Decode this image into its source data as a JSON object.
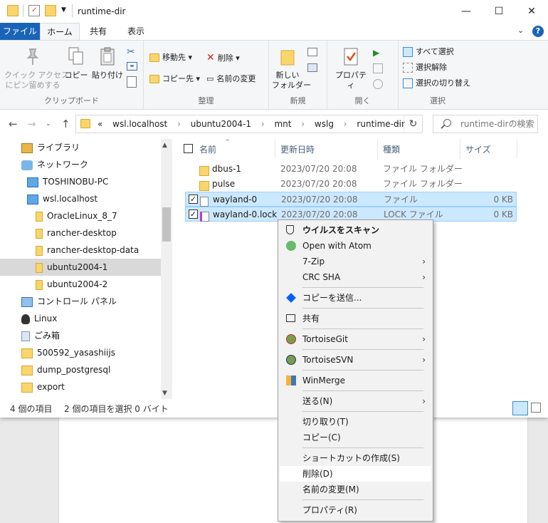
{
  "window": {
    "title": "runtime-dir",
    "controls": {
      "minimize": "—",
      "maximize": "☐",
      "close": "✕"
    }
  },
  "tabs": {
    "file": "ファイル",
    "home": "ホーム",
    "share": "共有",
    "view": "表示"
  },
  "ribbon": {
    "clipboard": {
      "label": "クリップボード",
      "pin": "クイック アクセス\nにピン留めする",
      "copy": "コピー",
      "paste": "貼り付け"
    },
    "organize": {
      "label": "整理",
      "move_to": "移動先",
      "copy_to": "コピー先",
      "delete": "削除",
      "rename": "名前の変更"
    },
    "new": {
      "label": "新規",
      "new_folder": "新しい\nフォルダー"
    },
    "open": {
      "label": "開く",
      "properties": "プロパティ"
    },
    "select": {
      "label": "選択",
      "select_all": "すべて選択",
      "select_none": "選択解除",
      "invert": "選択の切り替え"
    }
  },
  "address": {
    "overflow": "«",
    "path": [
      "wsl.localhost",
      "ubuntu2004-1",
      "mnt",
      "wslg",
      "runtime-dir"
    ],
    "separator": "›",
    "search_placeholder": "runtime-dirの検索"
  },
  "nav": {
    "items": [
      {
        "label": "ライブラリ",
        "icon": "library-icon",
        "selected": false
      },
      {
        "label": "ネットワーク",
        "icon": "network-icon",
        "selected": false
      },
      {
        "label": "TOSHINOBU-PC",
        "icon": "computer-icon",
        "selected": false
      },
      {
        "label": "wsl.localhost",
        "icon": "computer-icon",
        "selected": false
      },
      {
        "label": "OracleLinux_8_7",
        "icon": "network-folder-icon",
        "selected": false
      },
      {
        "label": "rancher-desktop",
        "icon": "network-folder-icon",
        "selected": false
      },
      {
        "label": "rancher-desktop-data",
        "icon": "network-folder-icon",
        "selected": false
      },
      {
        "label": "ubuntu2004-1",
        "icon": "network-folder-icon",
        "selected": true
      },
      {
        "label": "ubuntu2004-2",
        "icon": "network-folder-icon",
        "selected": false
      },
      {
        "label": "コントロール パネル",
        "icon": "control-panel-icon",
        "selected": false
      },
      {
        "label": "Linux",
        "icon": "linux-icon",
        "selected": false
      },
      {
        "label": "ごみ箱",
        "icon": "recycle-bin-icon",
        "selected": false
      },
      {
        "label": "500592_yasashiijs",
        "icon": "folder-icon",
        "selected": false
      },
      {
        "label": "dump_postgresql",
        "icon": "folder-icon",
        "selected": false
      },
      {
        "label": "export",
        "icon": "folder-icon",
        "selected": false
      }
    ]
  },
  "columns": {
    "name": "名前",
    "date": "更新日時",
    "type": "種類",
    "size": "サイズ"
  },
  "files": [
    {
      "name": "dbus-1",
      "date": "2023/07/20 20:08",
      "type": "ファイル フォルダー",
      "size": "",
      "icon": "folder-icon",
      "selected": false
    },
    {
      "name": "pulse",
      "date": "2023/07/20 20:08",
      "type": "ファイル フォルダー",
      "size": "",
      "icon": "folder-icon",
      "selected": false
    },
    {
      "name": "wayland-0",
      "date": "2023/07/20 20:08",
      "type": "ファイル",
      "size": "0 KB",
      "icon": "file-icon",
      "selected": true
    },
    {
      "name": "wayland-0.lock",
      "date": "2023/07/20 20:08",
      "type": "LOCK ファイル",
      "size": "0 KB",
      "icon": "lock-file-icon",
      "selected": true
    }
  ],
  "status": {
    "count": "4 個の項目",
    "selection": "2 個の項目を選択  0 バイト"
  },
  "context_menu": {
    "items": [
      {
        "label": "ウイルスをスキャン",
        "icon": "shield-icon",
        "bold": true,
        "submenu": false
      },
      {
        "label": "Open with Atom",
        "icon": "atom-icon",
        "bold": false,
        "submenu": false
      },
      {
        "label": "7-Zip",
        "icon": "",
        "bold": false,
        "submenu": true
      },
      {
        "label": "CRC SHA",
        "icon": "",
        "bold": false,
        "submenu": true
      },
      {
        "sep": true
      },
      {
        "label": "コピーを送信...",
        "icon": "dropbox-icon",
        "bold": false,
        "submenu": false
      },
      {
        "sep": true
      },
      {
        "label": "共有",
        "icon": "share-icon",
        "bold": false,
        "submenu": false
      },
      {
        "sep": true
      },
      {
        "label": "TortoiseGit",
        "icon": "tortoise-git-icon",
        "bold": false,
        "submenu": true
      },
      {
        "sep": true
      },
      {
        "label": "TortoiseSVN",
        "icon": "tortoise-svn-icon",
        "bold": false,
        "submenu": true
      },
      {
        "sep": true
      },
      {
        "label": "WinMerge",
        "icon": "winmerge-icon",
        "bold": false,
        "submenu": false
      },
      {
        "sep": true
      },
      {
        "label": "送る(N)",
        "icon": "",
        "bold": false,
        "submenu": true
      },
      {
        "sep": true
      },
      {
        "label": "切り取り(T)",
        "icon": "",
        "bold": false,
        "submenu": false
      },
      {
        "label": "コピー(C)",
        "icon": "",
        "bold": false,
        "submenu": false
      },
      {
        "sep": true
      },
      {
        "label": "ショートカットの作成(S)",
        "icon": "",
        "bold": false,
        "submenu": false
      },
      {
        "label": "削除(D)",
        "icon": "",
        "bold": false,
        "submenu": false,
        "highlighted": true
      },
      {
        "label": "名前の変更(M)",
        "icon": "",
        "bold": false,
        "submenu": false
      },
      {
        "sep": true
      },
      {
        "label": "プロパティ(R)",
        "icon": "",
        "bold": false,
        "submenu": false
      }
    ]
  },
  "colors": {
    "accent": "#1a64b8",
    "selection": "#cce8ff",
    "folder": "#f9d66c"
  }
}
